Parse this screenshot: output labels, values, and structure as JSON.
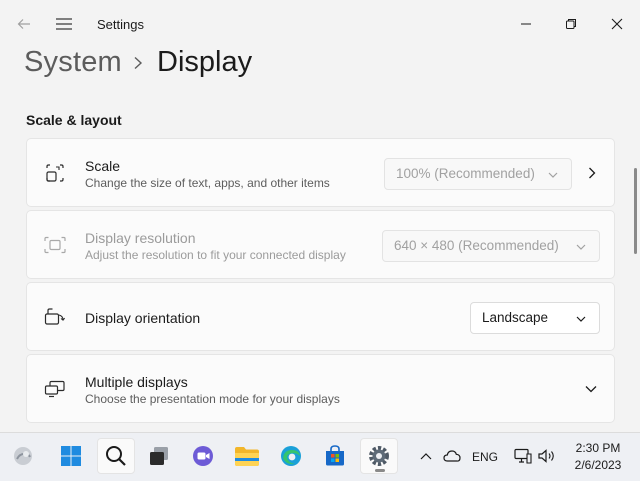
{
  "window": {
    "app_title": "Settings",
    "back_icon": "back-arrow-icon",
    "menu_icon": "hamburger-icon",
    "controls": [
      "minimize-icon",
      "maximize-icon",
      "close-icon"
    ]
  },
  "breadcrumb": {
    "parent": "System",
    "separator_icon": "chevron-right-icon",
    "current": "Display"
  },
  "section": {
    "header": "Scale & layout"
  },
  "settings": {
    "scale": {
      "icon": "scale-icon",
      "title": "Scale",
      "description": "Change the size of text, apps, and other items",
      "value": "100% (Recommended)",
      "enabled": false
    },
    "resolution": {
      "icon": "resolution-icon",
      "title": "Display resolution",
      "description": "Adjust the resolution to fit your connected display",
      "value": "640 × 480 (Recommended)",
      "enabled": false
    },
    "orientation": {
      "icon": "orientation-icon",
      "title": "Display orientation",
      "value": "Landscape",
      "enabled": true
    },
    "multiple": {
      "icon": "multiple-displays-icon",
      "title": "Multiple displays",
      "description": "Choose the presentation mode for your displays"
    }
  },
  "taskbar": {
    "items": [
      "widgets-icon",
      "start-icon",
      "search-icon",
      "task-view-icon",
      "chat-icon",
      "file-explorer-icon",
      "edge-icon",
      "store-icon",
      "settings-app-icon"
    ],
    "tray": {
      "language": "ENG",
      "time": "2:30 PM",
      "date": "2/6/2023"
    }
  },
  "colors": {
    "accent": "#0067c0",
    "background": "#f3f3f3",
    "card": "#fbfbfb",
    "disabled_text": "#9b9b9b"
  }
}
